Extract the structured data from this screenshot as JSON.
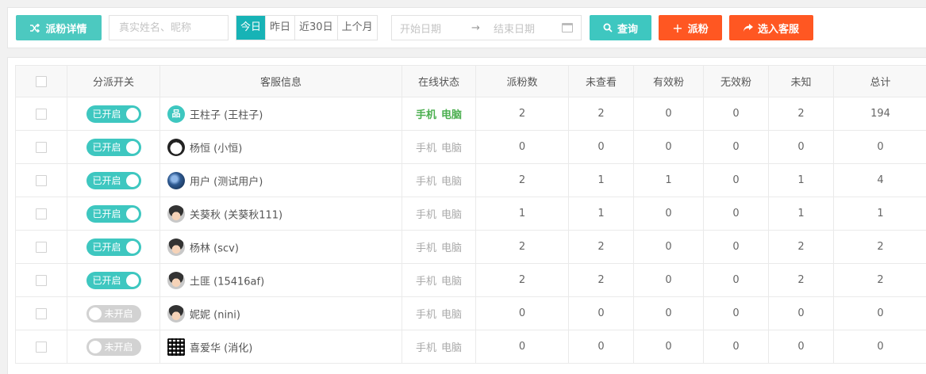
{
  "toolbar": {
    "detail_label": "派粉详情",
    "name_placeholder": "真实姓名、昵称",
    "date_tabs": [
      {
        "label": "今日",
        "active": true
      },
      {
        "label": "昨日",
        "active": false
      },
      {
        "label": "近30日",
        "active": false
      },
      {
        "label": "上个月",
        "active": false
      }
    ],
    "start_date_placeholder": "开始日期",
    "end_date_placeholder": "结束日期",
    "query_label": "查询",
    "fans_label": "派粉",
    "select_label": "选入客服"
  },
  "colors": {
    "teal": "#3ec7c0",
    "active_tab": "#17b3b6",
    "orange": "#ff5722",
    "online_green": "#4caf50",
    "switch_off": "#d2d2d2"
  },
  "icons": {
    "detail": "shuffle-icon",
    "query": "search-icon",
    "fans": "plus-icon",
    "select": "share-arrow-icon",
    "date": "calendar-icon"
  },
  "table": {
    "headers": [
      "分派开关",
      "客服信息",
      "在线状态",
      "派粉数",
      "未查看",
      "有效粉",
      "无效粉",
      "未知",
      "总计"
    ],
    "device_labels": {
      "mobile": "手机",
      "pc": "电脑"
    },
    "switch_on_label": "已开启",
    "switch_off_label": "未开启",
    "rows": [
      {
        "enabled": true,
        "avatar": "teal-logo",
        "name": "王柱子 (王柱子)",
        "online": true,
        "dispatched": "2",
        "unviewed": "2",
        "valid": "0",
        "invalid": "0",
        "unknown": "2",
        "total": "194"
      },
      {
        "enabled": true,
        "avatar": "panda",
        "name": "杨恒 (小恒)",
        "online": false,
        "dispatched": "0",
        "unviewed": "0",
        "valid": "0",
        "invalid": "0",
        "unknown": "0",
        "total": "0"
      },
      {
        "enabled": true,
        "avatar": "blue-photo",
        "name": "用户 (测试用户)",
        "online": false,
        "dispatched": "2",
        "unviewed": "1",
        "valid": "1",
        "invalid": "0",
        "unknown": "1",
        "total": "4"
      },
      {
        "enabled": true,
        "avatar": "default-face",
        "name": "关葵秋 (关葵秋111)",
        "online": false,
        "dispatched": "1",
        "unviewed": "1",
        "valid": "0",
        "invalid": "0",
        "unknown": "1",
        "total": "1"
      },
      {
        "enabled": true,
        "avatar": "default-face",
        "name": "杨林 (scv)",
        "online": false,
        "dispatched": "2",
        "unviewed": "2",
        "valid": "0",
        "invalid": "0",
        "unknown": "2",
        "total": "2"
      },
      {
        "enabled": true,
        "avatar": "default-face",
        "name": "土匪 (15416af)",
        "online": false,
        "dispatched": "2",
        "unviewed": "2",
        "valid": "0",
        "invalid": "0",
        "unknown": "2",
        "total": "2"
      },
      {
        "enabled": false,
        "avatar": "default-face",
        "name": "妮妮 (nini)",
        "online": false,
        "dispatched": "0",
        "unviewed": "0",
        "valid": "0",
        "invalid": "0",
        "unknown": "0",
        "total": "0"
      },
      {
        "enabled": false,
        "avatar": "qr-code",
        "name": "喜爱华 (消化)",
        "online": false,
        "dispatched": "0",
        "unviewed": "0",
        "valid": "0",
        "invalid": "0",
        "unknown": "0",
        "total": "0"
      }
    ]
  }
}
